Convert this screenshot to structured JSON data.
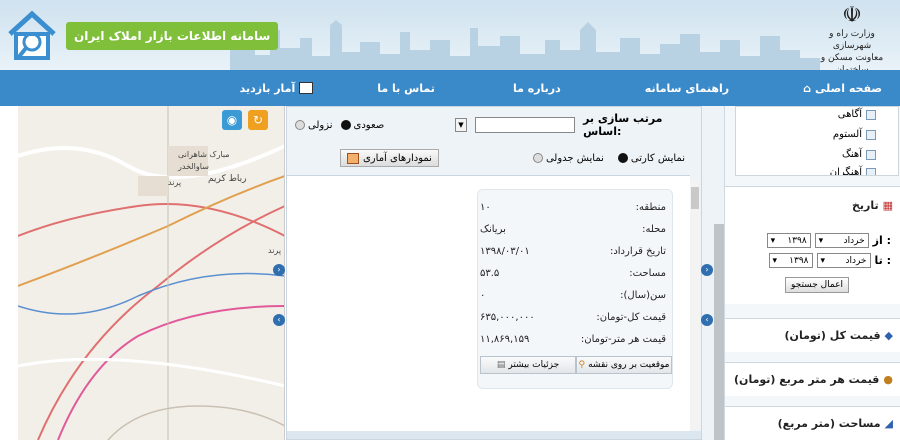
{
  "header": {
    "site_title": "سامانه اطلاعات بازار املاک ایران",
    "ministry_line1": "وزارت راه و شهرسازی",
    "ministry_line2": "معاونت مسکن و ساختمان"
  },
  "nav": {
    "home": "صفحه اصلی",
    "guide": "راهنمای سامانه",
    "about": "درباره ما",
    "contact": "تماس با ما",
    "stats": "آمار بازدید"
  },
  "map": {
    "labels": [
      "مبارک شاهرانی",
      "ساوالخدر",
      "پرند",
      "رباط کریم",
      "پرند"
    ]
  },
  "sort": {
    "label": "مرتب سازی بر اساس:",
    "ascending": "صعودی",
    "descending": "نزولی"
  },
  "view": {
    "card": "نمایش کارتی",
    "table": "نمایش جدولی",
    "stats_button": "نمودارهای آماری"
  },
  "listing": {
    "fields": [
      {
        "key": "منطقه:",
        "value": "۱۰"
      },
      {
        "key": "محله:",
        "value": "بریانک"
      },
      {
        "key": "تاریخ قرارداد:",
        "value": "۱۳۹۸/۰۳/۰۱"
      },
      {
        "key": "مساحت:",
        "value": "۵۳.۵"
      },
      {
        "key": "سن(سال):",
        "value": "۰"
      },
      {
        "key": "قیمت کل-تومان:",
        "value": "۶۳۵,۰۰۰,۰۰۰"
      },
      {
        "key": "قیمت هر متر-تومان:",
        "value": "۱۱,۸۶۹,۱۵۹"
      }
    ],
    "map_button": "موقعیت بر روی نقشه",
    "details_button": "جزئیات بیشتر"
  },
  "filters": {
    "checklist": [
      "آگاهی",
      "آلستوم",
      "آهنگ",
      "آهنگران"
    ],
    "date_title": "تاریخ",
    "from_label": "از :",
    "to_label": "تا :",
    "from_month": "خرداد",
    "from_year": "۱۳۹۸",
    "to_month": "خرداد",
    "to_year": "۱۳۹۸",
    "apply": "اعمال جستجو",
    "total_price": "قیمت کل (تومان)",
    "price_per_meter": "قیمت هر متر مربع (تومان)",
    "area": "مساحت (متر مربع)"
  },
  "colors": {
    "nav_blue": "#3a89c9",
    "title_green": "#7fbf3a",
    "map_road_red": "#e07070",
    "map_road_pink": "#e05a9a",
    "map_road_blue": "#5a8fd0"
  }
}
